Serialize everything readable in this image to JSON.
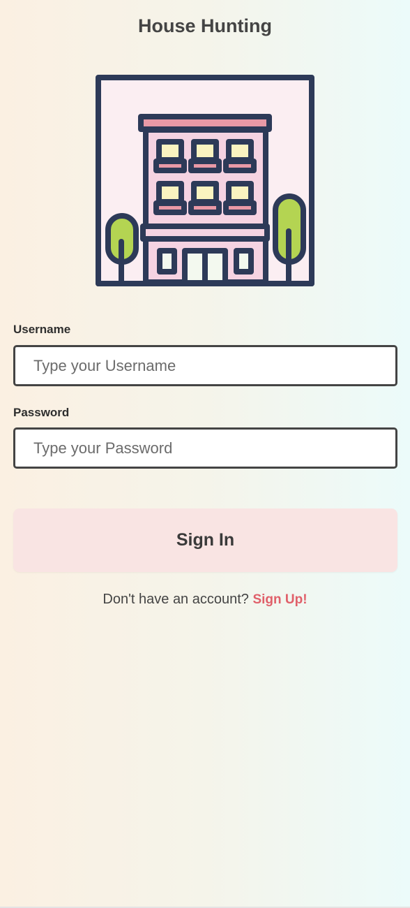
{
  "app": {
    "title": "House Hunting"
  },
  "illustration": {
    "icon": "apartment-building-icon"
  },
  "form": {
    "username": {
      "label": "Username",
      "placeholder": "Type your Username",
      "value": ""
    },
    "password": {
      "label": "Password",
      "placeholder": "Type your Password",
      "value": ""
    },
    "submit_label": "Sign In"
  },
  "footer": {
    "prompt": "Don't have an account?",
    "link": "Sign Up!"
  },
  "colors": {
    "accent": "#e0606a",
    "button_bg": "#f9e4e3",
    "outline": "#2d3a58"
  }
}
